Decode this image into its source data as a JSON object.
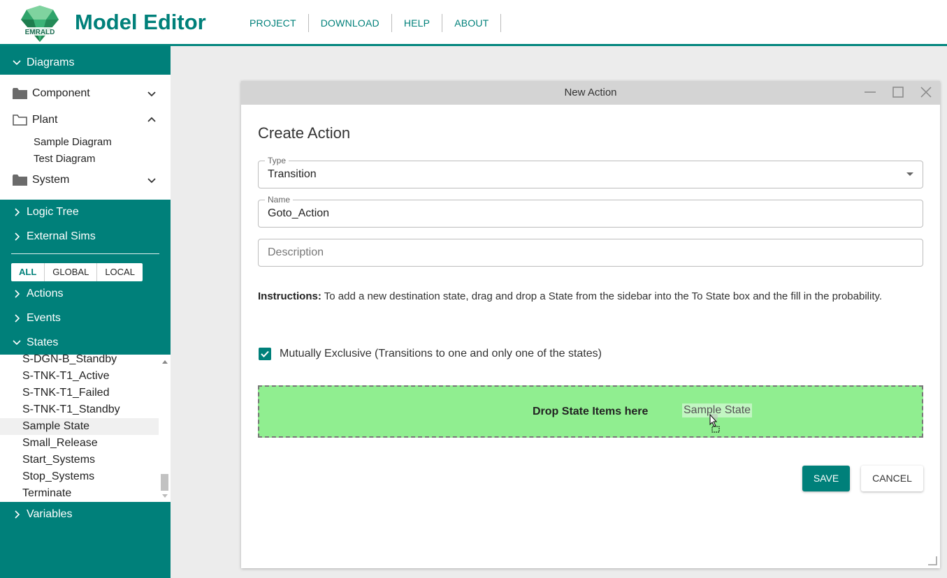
{
  "header": {
    "logo_text": "EMRALD",
    "title": "Model Editor",
    "nav": [
      "PROJECT",
      "DOWNLOAD",
      "HELP",
      "ABOUT"
    ]
  },
  "sidebar": {
    "diagrams_label": "Diagrams",
    "folders": {
      "component": "Component",
      "plant": "Plant",
      "system": "System"
    },
    "plant_items": [
      "Sample Diagram",
      "Test Diagram"
    ],
    "logic_tree_label": "Logic Tree",
    "external_sims_label": "External Sims",
    "filters": [
      "ALL",
      "GLOBAL",
      "LOCAL"
    ],
    "actions_label": "Actions",
    "events_label": "Events",
    "states_label": "States",
    "states": [
      "S-DGN-B_Standby",
      "S-TNK-T1_Active",
      "S-TNK-T1_Failed",
      "S-TNK-T1_Standby",
      "Sample State",
      "Small_Release",
      "Start_Systems",
      "Stop_Systems",
      "Terminate"
    ],
    "variables_label": "Variables"
  },
  "dialog": {
    "window_title": "New Action",
    "heading": "Create Action",
    "type_label": "Type",
    "type_value": "Transition",
    "name_label": "Name",
    "name_value": "Goto_Action",
    "description_placeholder": "Description",
    "instructions_bold": "Instructions:",
    "instructions_text": "To add a new destination state, drag and drop a State from the sidebar into the To State box and the fill in the probability.",
    "mutually_exclusive_label": "Mutually Exclusive (Transitions to one and only one of the states)",
    "mutually_exclusive_checked": true,
    "drop_zone_text": "Drop State Items here",
    "dragged_item": "Sample State",
    "save_label": "SAVE",
    "cancel_label": "CANCEL"
  },
  "colors": {
    "brand": "#00807a",
    "drop_zone": "#90ee90",
    "dialog_titlebar": "#d4d4d4"
  }
}
